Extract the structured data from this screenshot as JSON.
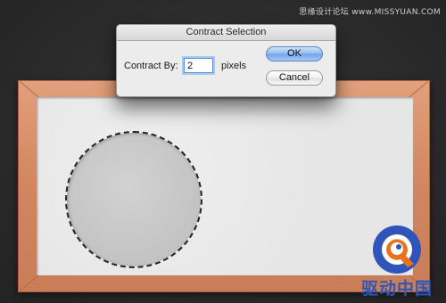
{
  "watermark": {
    "text": "思缘设计论坛 www.MISSYUAN.COM"
  },
  "dialog": {
    "title": "Contract Selection",
    "contract_label": "Contract By:",
    "contract_value": "2",
    "unit": "pixels",
    "ok_label": "OK",
    "cancel_label": "Cancel"
  },
  "logo": {
    "text": "驱动中国"
  },
  "colors": {
    "frame": "#d1865f",
    "canvas": "#e6e6e6",
    "ok_button": "#8fb9ee",
    "logo_blue": "#2f55b8",
    "logo_orange": "#e8731f"
  }
}
